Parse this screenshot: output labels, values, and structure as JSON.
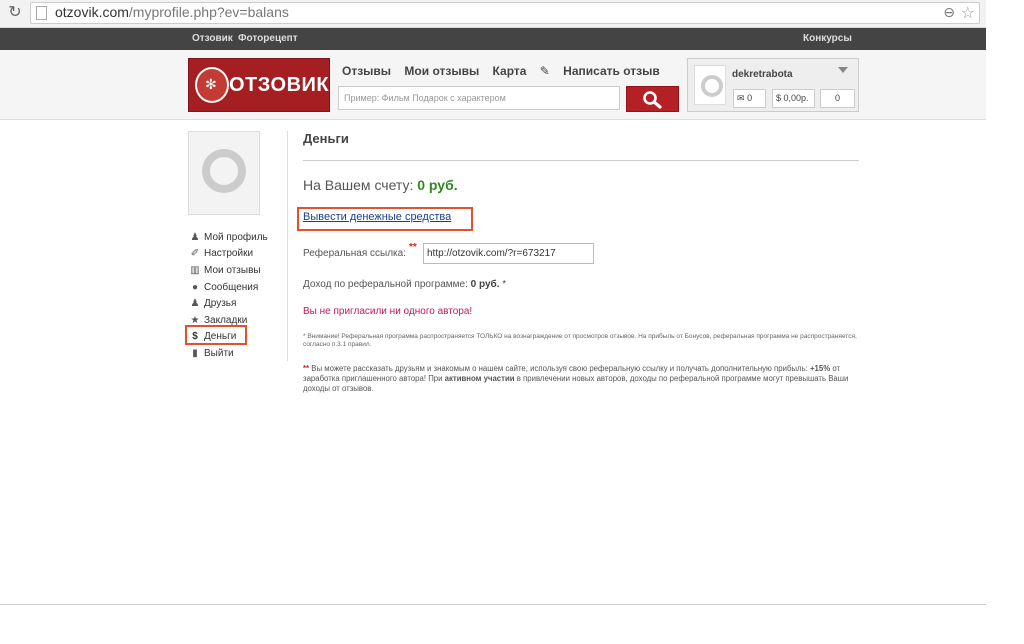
{
  "browser": {
    "url_domain": "otzovik.com",
    "url_path": "/myprofile.php?ev=balans"
  },
  "topbar": {
    "left_links": [
      "Отзовик",
      "Фоторецепт"
    ],
    "right_link": "Конкурсы"
  },
  "header": {
    "logo_text": "ОТЗОВИК",
    "nav": [
      "Отзывы",
      "Мои отзывы",
      "Карта"
    ],
    "write_review": "Написать отзыв",
    "search_placeholder": "Пример: Фильм Подарок с характером"
  },
  "user": {
    "name": "dekretrabota",
    "messages": "0",
    "balance": "0,00р.",
    "third_count": "0"
  },
  "sidebar": {
    "items": [
      {
        "label": "Мой профиль",
        "icon": "person-icon"
      },
      {
        "label": "Настройки",
        "icon": "wrench-icon"
      },
      {
        "label": "Мои отзывы",
        "icon": "reviews-icon"
      },
      {
        "label": "Сообщения",
        "icon": "chat-icon"
      },
      {
        "label": "Друзья",
        "icon": "friends-icon"
      },
      {
        "label": "Закладки",
        "icon": "star-icon"
      },
      {
        "label": "Деньги",
        "icon": "dollar-icon"
      },
      {
        "label": "Выйти",
        "icon": "exit-icon"
      }
    ]
  },
  "main": {
    "title": "Деньги",
    "balance_label": "На Вашем счету:",
    "balance_value": "0 руб.",
    "withdraw_link": "Вывести денежные средства",
    "ref_label": "Реферальная ссылка:",
    "ref_mark": "**",
    "ref_url": "http://otzovik.com/?r=673217",
    "income_label": "Доход по реферальной программе:",
    "income_value": "0 руб.",
    "income_mark": "*",
    "no_invite": "Вы не пригласили ни одного автора!",
    "note": "* Внимание! Реферальная программа распространяется ТОЛЬКО на вознаграждение от просмотров отзывов. На прибыль от Бонусов, реферальная программа не распространяется, согласно п.3.1 правил.",
    "promo_stars": "**",
    "promo_a": "Вы можете рассказать друзьям и знакомым о нашем сайте, используя свою реферальную ссылку и получать дополнительную прибыль:",
    "promo_b": "+15%",
    "promo_c": "от заработка приглашенного автора! При",
    "promo_d": "активном участии",
    "promo_e": "в привлечении новых авторов, доходы по реферальной программе могут превышать Ваши доходы от отзывов."
  }
}
